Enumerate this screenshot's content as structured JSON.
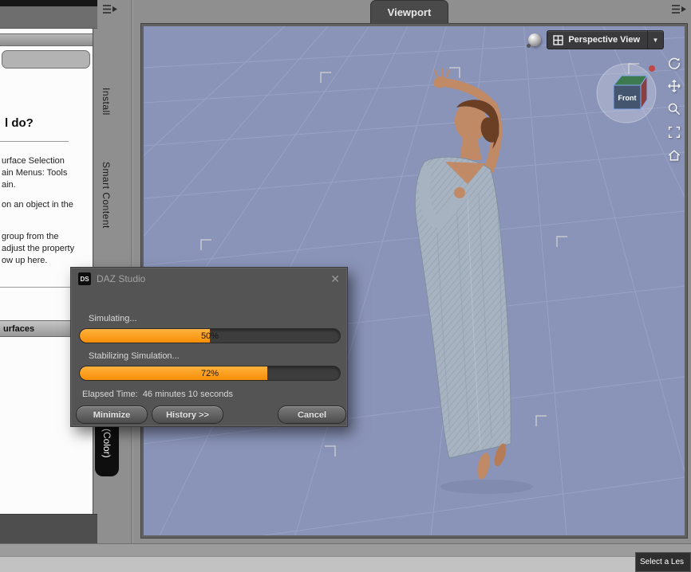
{
  "left_panel": {
    "heading_fragment": "l do?",
    "lines": [
      "urface Selection",
      "ain Menus: Tools",
      "ain.",
      "on an object in the",
      "group from the",
      "adjust the property",
      "ow up here."
    ],
    "surfaces_bar": "urfaces",
    "tabs": [
      "Install",
      "Smart Content"
    ],
    "color_tab": "(Color)"
  },
  "viewport": {
    "tab_label": "Viewport",
    "view_selector_label": "Perspective View",
    "cube_front_label": "Front"
  },
  "dialog": {
    "icon_text": "DS",
    "title": "DAZ Studio",
    "close_glyph": "✕",
    "sections": [
      {
        "label": "Simulating...",
        "percent": 50,
        "percent_text": "50%"
      },
      {
        "label": "Stabilizing Simulation...",
        "percent": 72,
        "percent_text": "72%"
      }
    ],
    "elapsed_text": "Elapsed Time:  46 minutes 10 seconds",
    "buttons": [
      "Minimize",
      "History >>",
      "Cancel"
    ]
  },
  "status": {
    "bottom_right": "Select a Les"
  },
  "icons": {
    "dropdown_arrow": "▼"
  },
  "colors": {
    "accent_orange": "#f78f06",
    "viewport_bg": "#8a94b8",
    "dialog_bg": "#545454"
  }
}
